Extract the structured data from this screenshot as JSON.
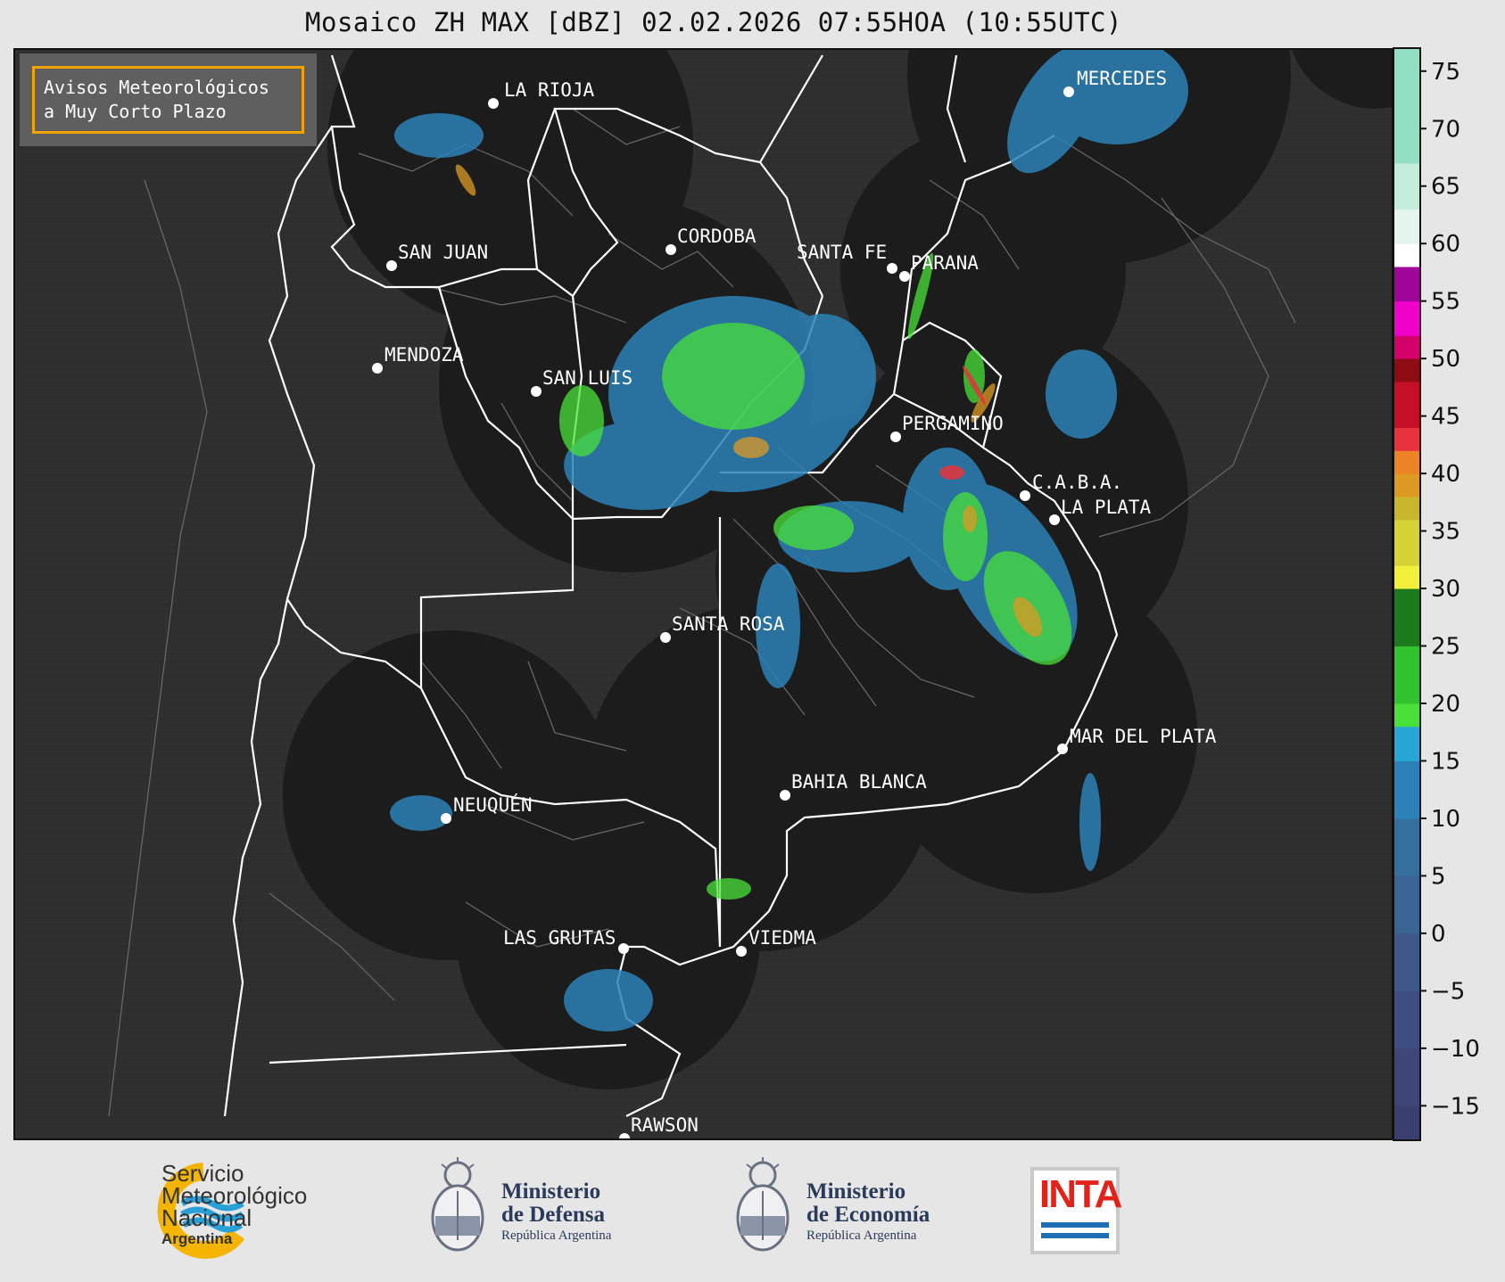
{
  "title": "Mosaico ZH MAX [dBZ] 02.02.2026 07:55HOA (10:55UTC)",
  "avisos": {
    "line1": "Avisos Meteorológicos",
    "line2": "a Muy Corto Plazo",
    "border_color": "#f5a300"
  },
  "cities": [
    {
      "name": "LA RIOJA"
    },
    {
      "name": "MERCEDES"
    },
    {
      "name": "CORDOBA"
    },
    {
      "name": "SAN JUAN"
    },
    {
      "name": "SANTA FE"
    },
    {
      "name": "PARANA"
    },
    {
      "name": "MENDOZA"
    },
    {
      "name": "SAN LUIS"
    },
    {
      "name": "PERGAMINO"
    },
    {
      "name": "C.A.B.A."
    },
    {
      "name": "LA PLATA"
    },
    {
      "name": "SANTA ROSA"
    },
    {
      "name": "MAR DEL PLATA"
    },
    {
      "name": "BAHIA BLANCA"
    },
    {
      "name": "NEUQUÉN"
    },
    {
      "name": "LAS GRUTAS"
    },
    {
      "name": "VIEDMA"
    },
    {
      "name": "RAWSON"
    }
  ],
  "colorbar": {
    "unit": "dBZ",
    "min": -18,
    "max": 77,
    "ticks": [
      "75",
      "70",
      "65",
      "60",
      "55",
      "50",
      "45",
      "40",
      "35",
      "30",
      "25",
      "20",
      "15",
      "10",
      "5",
      "0",
      "−5",
      "−10",
      "−15"
    ],
    "tick_values": [
      75,
      70,
      65,
      60,
      55,
      50,
      45,
      40,
      35,
      30,
      25,
      20,
      15,
      10,
      5,
      0,
      -5,
      -10,
      -15
    ],
    "bands": [
      {
        "from": -18,
        "to": -15,
        "color": "#3a3f6e"
      },
      {
        "from": -15,
        "to": -10,
        "color": "#3d4676"
      },
      {
        "from": -10,
        "to": -5,
        "color": "#3f4e80"
      },
      {
        "from": -5,
        "to": 0,
        "color": "#3e5888"
      },
      {
        "from": 0,
        "to": 5,
        "color": "#3b6394"
      },
      {
        "from": 5,
        "to": 10,
        "color": "#356f9e"
      },
      {
        "from": 10,
        "to": 15,
        "color": "#2c82b8"
      },
      {
        "from": 15,
        "to": 18,
        "color": "#27a6d6"
      },
      {
        "from": 18,
        "to": 20,
        "color": "#49e039"
      },
      {
        "from": 20,
        "to": 25,
        "color": "#33c22f"
      },
      {
        "from": 25,
        "to": 30,
        "color": "#1d7a1c"
      },
      {
        "from": 30,
        "to": 32,
        "color": "#f2ef3a"
      },
      {
        "from": 32,
        "to": 36,
        "color": "#d5d236"
      },
      {
        "from": 36,
        "to": 38,
        "color": "#c9b62c"
      },
      {
        "from": 38,
        "to": 40,
        "color": "#dc9a22"
      },
      {
        "from": 40,
        "to": 42,
        "color": "#ec8425"
      },
      {
        "from": 42,
        "to": 44,
        "color": "#e8323c"
      },
      {
        "from": 44,
        "to": 48,
        "color": "#c40f26"
      },
      {
        "from": 48,
        "to": 50,
        "color": "#8e0b14"
      },
      {
        "from": 50,
        "to": 52,
        "color": "#d4006a"
      },
      {
        "from": 52,
        "to": 55,
        "color": "#ee00c8"
      },
      {
        "from": 55,
        "to": 58,
        "color": "#a0059a"
      },
      {
        "from": 58,
        "to": 60,
        "color": "#ffffff"
      },
      {
        "from": 60,
        "to": 63,
        "color": "#e3f5ec"
      },
      {
        "from": 63,
        "to": 67,
        "color": "#c4ecdb"
      },
      {
        "from": 67,
        "to": 77,
        "color": "#92dfc3"
      }
    ]
  },
  "logos": {
    "smn": {
      "line1": "Servicio",
      "line2": "Meteorológico",
      "line3": "Nacional",
      "line4": "Argentina"
    },
    "defensa": {
      "line1": "Ministerio",
      "line2": "de Defensa",
      "line3": "República Argentina"
    },
    "economia": {
      "line1": "Ministerio",
      "line2": "de Economía",
      "line3": "República Argentina"
    },
    "inta": {
      "text": "INTA"
    }
  }
}
